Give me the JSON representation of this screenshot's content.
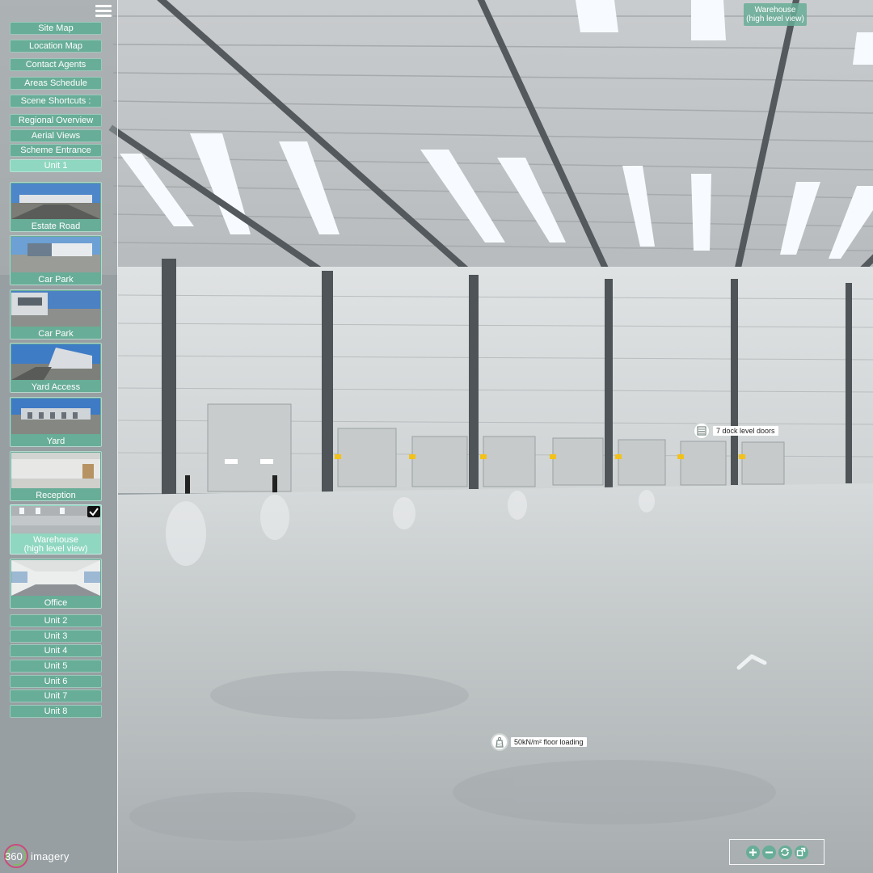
{
  "colors": {
    "accent": "#68ad97",
    "accent_active": "#8fd7c0",
    "text": "#ffffff"
  },
  "menu": {
    "icon": "hamburger-icon",
    "buttons": [
      "Site Map",
      "Location Map",
      "Contact Agents",
      "Areas Schedule",
      "Scene Shortcuts :"
    ],
    "shortcuts": [
      "Regional Overview",
      "Aerial Views",
      "Scheme Entrance"
    ],
    "current_unit": "Unit 1",
    "scenes": [
      "Estate Road",
      "Car Park",
      "Car Park",
      "Yard Access",
      "Yard",
      "Reception",
      "Warehouse\n(high level view)",
      "Office"
    ],
    "active_scene": "Warehouse (high level view)",
    "units": [
      "Unit 2",
      "Unit 3",
      "Unit 4",
      "Unit 5",
      "Unit 6",
      "Unit 7",
      "Unit 8"
    ]
  },
  "scene": {
    "title_line1": "Warehouse",
    "title_line2": "(high level view)"
  },
  "hotspots": {
    "doors": {
      "label": "7 dock level doors",
      "icon": "door-icon"
    },
    "floor": {
      "label": "50kN/m² floor loading",
      "icon": "weight-icon"
    }
  },
  "controls": {
    "zoom_in": "plus-icon",
    "zoom_out": "minus-icon",
    "autorotate": "rotate-icon",
    "fullscreen": "fullscreen-icon"
  },
  "logo": {
    "number": "360",
    "brand": "imagery"
  }
}
